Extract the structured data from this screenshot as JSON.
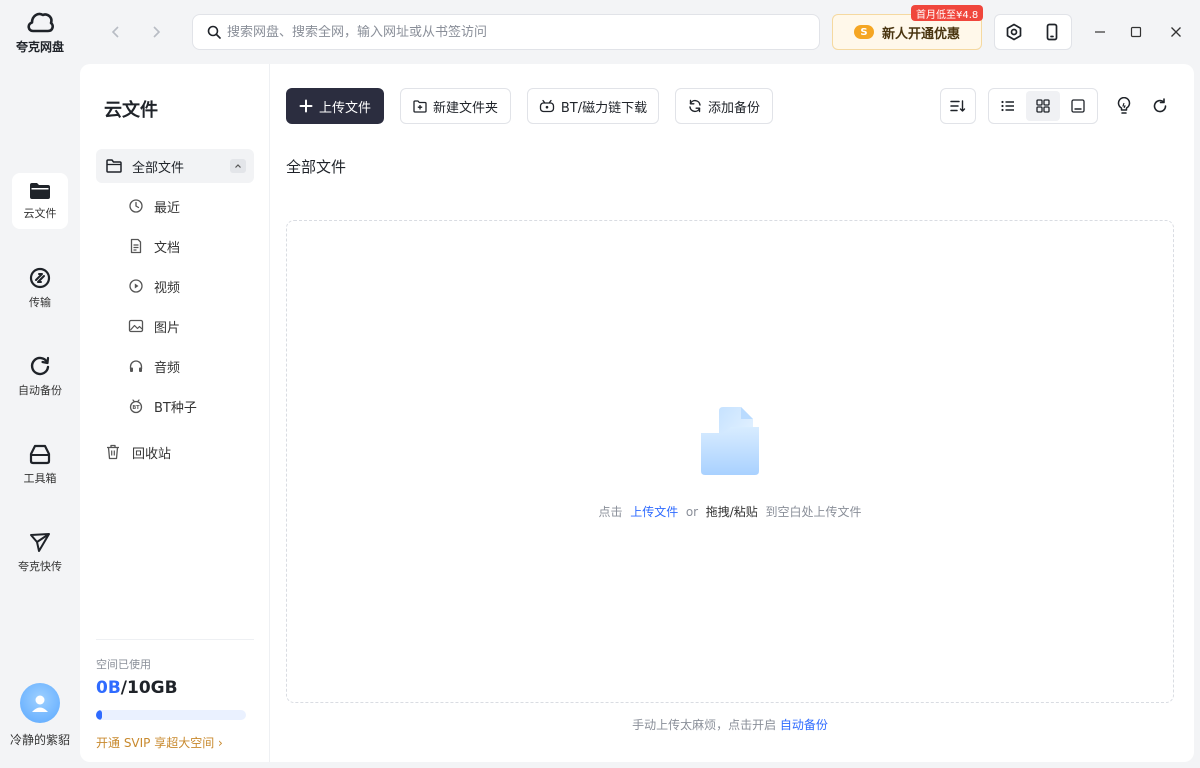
{
  "app": {
    "name": "夸克网盘"
  },
  "rail": {
    "items": [
      {
        "label": "云文件",
        "icon": "folder-icon",
        "active": true
      },
      {
        "label": "传输",
        "icon": "transfer-icon",
        "active": false
      },
      {
        "label": "自动备份",
        "icon": "backup-icon",
        "active": false
      },
      {
        "label": "工具箱",
        "icon": "toolbox-icon",
        "active": false
      },
      {
        "label": "夸克快传",
        "icon": "send-icon",
        "active": false
      }
    ],
    "user": {
      "name": "冷静的紫貂"
    }
  },
  "header": {
    "search_placeholder": "搜索网盘、搜索全网，输入网址或从书签访问",
    "promo": {
      "label": "新人开通优惠",
      "badge": "首月低至¥4.8",
      "coin": "S"
    }
  },
  "sidebar": {
    "title": "云文件",
    "root": "全部文件",
    "items": [
      {
        "label": "最近",
        "icon": "clock-icon"
      },
      {
        "label": "文档",
        "icon": "document-icon"
      },
      {
        "label": "视频",
        "icon": "video-icon"
      },
      {
        "label": "图片",
        "icon": "image-icon"
      },
      {
        "label": "音频",
        "icon": "headphones-icon"
      },
      {
        "label": "BT种子",
        "icon": "bt-icon"
      }
    ],
    "trash": "回收站",
    "storage": {
      "label": "空间已使用",
      "used": "0B",
      "sep": "/",
      "total": "10GB",
      "used_fraction": 0.02
    },
    "upgrade": "开通 SVIP 享超大空间 ›"
  },
  "toolbar": {
    "upload": "上传文件",
    "new_folder": "新建文件夹",
    "bt_download": "BT/磁力链下载",
    "add_backup": "添加备份"
  },
  "main": {
    "breadcrumb": "全部文件",
    "empty": {
      "pre": "点击",
      "link": "上传文件",
      "mid": "or",
      "drag": "拖拽/粘贴",
      "post": "到空白处上传文件"
    },
    "hint": {
      "text": "手动上传太麻烦，点击开启",
      "link": "自动备份"
    }
  },
  "colors": {
    "accent": "#2f6bff",
    "primary_button": "#2b2d3f",
    "promo_badge": "#f0463c",
    "upgrade": "#c8892d"
  }
}
